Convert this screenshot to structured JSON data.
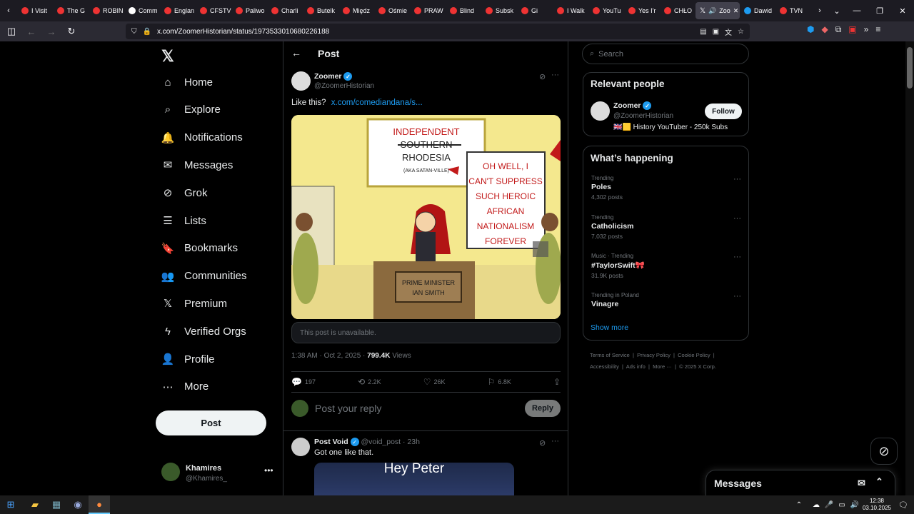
{
  "browser": {
    "tabs": [
      {
        "label": "I Visit",
        "color": "#e33"
      },
      {
        "label": "The G",
        "color": "#e33"
      },
      {
        "label": "ROBIN",
        "color": "#e33"
      },
      {
        "label": "Comm",
        "color": "#fff"
      },
      {
        "label": "Englan",
        "color": "#e33"
      },
      {
        "label": "CFSTV",
        "color": "#e33"
      },
      {
        "label": "Paliwo",
        "color": "#e33"
      },
      {
        "label": "Charli",
        "color": "#e33"
      },
      {
        "label": "Butelk",
        "color": "#e33"
      },
      {
        "label": "Międz",
        "color": "#e33"
      },
      {
        "label": "Ośmie",
        "color": "#e33"
      },
      {
        "label": "PRAW",
        "color": "#e33"
      },
      {
        "label": "Blind",
        "color": "#e33"
      },
      {
        "label": "Subsk",
        "color": "#e33"
      },
      {
        "label": "Gi",
        "color": "#e33"
      },
      {
        "label": "I Walk",
        "color": "#e33"
      },
      {
        "label": "YouTu",
        "color": "#e33"
      },
      {
        "label": "Yes I'r",
        "color": "#e33"
      },
      {
        "label": "CHŁO",
        "color": "#e33"
      }
    ],
    "active_tab": "Zoo",
    "after_tabs": [
      {
        "label": "Dawid",
        "color": "#1d9bf0"
      },
      {
        "label": "TVN",
        "color": "#e33"
      }
    ],
    "url": "x.com/ZoomerHistorian/status/1973533010680226188"
  },
  "sidebar": {
    "logo": "𝕏",
    "items": [
      {
        "label": "Home",
        "icon": "⌂"
      },
      {
        "label": "Explore",
        "icon": "⌕"
      },
      {
        "label": "Notifications",
        "icon": "🔔"
      },
      {
        "label": "Messages",
        "icon": "✉"
      },
      {
        "label": "Grok",
        "icon": "⊘"
      },
      {
        "label": "Lists",
        "icon": "☰"
      },
      {
        "label": "Bookmarks",
        "icon": "🔖"
      },
      {
        "label": "Communities",
        "icon": "👥"
      },
      {
        "label": "Premium",
        "icon": "𝕏"
      },
      {
        "label": "Verified Orgs",
        "icon": "ϟ"
      },
      {
        "label": "Profile",
        "icon": "👤"
      },
      {
        "label": "More",
        "icon": "⋯"
      }
    ],
    "post_button": "Post",
    "account": {
      "name": "Khamires",
      "handle": "@Khamires_"
    }
  },
  "main": {
    "header_title": "Post",
    "author": {
      "name": "Zoomer",
      "handle": "@ZoomerHistorian"
    },
    "text": "Like this?",
    "link_text": "x.com/comediandana/s...",
    "cartoon": {
      "sign_line1": "INDEPENDENT",
      "sign_line2": "SOUTHERN",
      "sign_line3": "RHODESIA",
      "sign_line4": "(AKA SATAN-VILLE)",
      "speech": [
        "OH WELL, I",
        "CAN'T SUPPRESS",
        "SUCH HEROIC",
        "AFRICAN",
        "NATIONALISM",
        "FOREVER"
      ],
      "desk_line1": "PRIME MINISTER",
      "desk_line2": "IAN SMITH"
    },
    "unavailable": "This post is unavailable.",
    "meta_time": "1:38 AM · Oct 2, 2025 · ",
    "meta_views": "799.4K",
    "meta_views_label": " Views",
    "stats": {
      "replies": "197",
      "reposts": "2.2K",
      "likes": "26K",
      "bookmarks": "6.8K"
    },
    "reply_placeholder": "Post your reply",
    "reply_button": "Reply",
    "reply_post": {
      "name": "Post Void",
      "handle": "@void_post",
      "time": "· 23h",
      "text": "Got one like that.",
      "image_text": "Hey Peter"
    }
  },
  "right": {
    "search_placeholder": "Search",
    "relevant_title": "Relevant people",
    "person": {
      "name": "Zoomer",
      "handle": "@ZoomerHistorian",
      "bio": "🇬🇧🟨 History YouTuber - 250k Subs",
      "follow": "Follow"
    },
    "happening_title": "What’s happening",
    "trends": [
      {
        "category": "Trending",
        "name": "Poles",
        "count": "4,302 posts"
      },
      {
        "category": "Trending",
        "name": "Catholicism",
        "count": "7,032 posts"
      },
      {
        "category": "Music · Trending",
        "name": "#TaylorSwift🎀",
        "count": "31.9K posts"
      },
      {
        "category": "Trending in Poland",
        "name": "Vinagre",
        "count": ""
      }
    ],
    "show_more": "Show more",
    "footer": [
      "Terms of Service",
      "Privacy Policy",
      "Cookie Policy",
      "Accessibility",
      "Ads info",
      "More ···",
      "© 2025 X Corp."
    ]
  },
  "messages_label": "Messages",
  "taskbar": {
    "time": "12:38",
    "date": "03.10.2025"
  }
}
